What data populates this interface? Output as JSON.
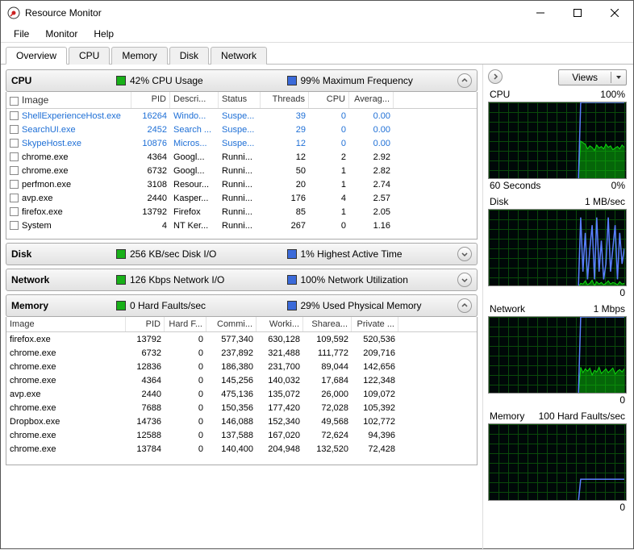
{
  "window": {
    "title": "Resource Monitor"
  },
  "menu": {
    "file": "File",
    "monitor": "Monitor",
    "help": "Help"
  },
  "tabs": {
    "overview": "Overview",
    "cpu": "CPU",
    "memory": "Memory",
    "disk": "Disk",
    "network": "Network"
  },
  "sections": {
    "cpu": {
      "title": "CPU",
      "m1": "42% CPU Usage",
      "m2": "99% Maximum Frequency",
      "cols": {
        "image": "Image",
        "pid": "PID",
        "desc": "Descri...",
        "status": "Status",
        "threads": "Threads",
        "cpu": "CPU",
        "avg": "Averag..."
      }
    },
    "disk": {
      "title": "Disk",
      "m1": "256 KB/sec Disk I/O",
      "m2": "1% Highest Active Time"
    },
    "network": {
      "title": "Network",
      "m1": "126 Kbps Network I/O",
      "m2": "100% Network Utilization"
    },
    "memory": {
      "title": "Memory",
      "m1": "0 Hard Faults/sec",
      "m2": "29% Used Physical Memory",
      "cols": {
        "image": "Image",
        "pid": "PID",
        "hard": "Hard F...",
        "commit": "Commi...",
        "work": "Worki...",
        "share": "Sharea...",
        "priv": "Private ..."
      }
    }
  },
  "cpu_rows": [
    {
      "image": "ShellExperienceHost.exe",
      "pid": "16264",
      "desc": "Windo...",
      "status": "Suspe...",
      "threads": "39",
      "cpu": "0",
      "avg": "0.00",
      "susp": true
    },
    {
      "image": "SearchUI.exe",
      "pid": "2452",
      "desc": "Search ...",
      "status": "Suspe...",
      "threads": "29",
      "cpu": "0",
      "avg": "0.00",
      "susp": true
    },
    {
      "image": "SkypeHost.exe",
      "pid": "10876",
      "desc": "Micros...",
      "status": "Suspe...",
      "threads": "12",
      "cpu": "0",
      "avg": "0.00",
      "susp": true
    },
    {
      "image": "chrome.exe",
      "pid": "4364",
      "desc": "Googl...",
      "status": "Runni...",
      "threads": "12",
      "cpu": "2",
      "avg": "2.92"
    },
    {
      "image": "chrome.exe",
      "pid": "6732",
      "desc": "Googl...",
      "status": "Runni...",
      "threads": "50",
      "cpu": "1",
      "avg": "2.82"
    },
    {
      "image": "perfmon.exe",
      "pid": "3108",
      "desc": "Resour...",
      "status": "Runni...",
      "threads": "20",
      "cpu": "1",
      "avg": "2.74"
    },
    {
      "image": "avp.exe",
      "pid": "2440",
      "desc": "Kasper...",
      "status": "Runni...",
      "threads": "176",
      "cpu": "4",
      "avg": "2.57"
    },
    {
      "image": "firefox.exe",
      "pid": "13792",
      "desc": "Firefox",
      "status": "Runni...",
      "threads": "85",
      "cpu": "1",
      "avg": "2.05"
    },
    {
      "image": "System",
      "pid": "4",
      "desc": "NT Ker...",
      "status": "Runni...",
      "threads": "267",
      "cpu": "0",
      "avg": "1.16"
    }
  ],
  "mem_rows": [
    {
      "image": "firefox.exe",
      "pid": "13792",
      "hard": "0",
      "commit": "577,340",
      "work": "630,128",
      "share": "109,592",
      "priv": "520,536"
    },
    {
      "image": "chrome.exe",
      "pid": "6732",
      "hard": "0",
      "commit": "237,892",
      "work": "321,488",
      "share": "111,772",
      "priv": "209,716"
    },
    {
      "image": "chrome.exe",
      "pid": "12836",
      "hard": "0",
      "commit": "186,380",
      "work": "231,700",
      "share": "89,044",
      "priv": "142,656"
    },
    {
      "image": "chrome.exe",
      "pid": "4364",
      "hard": "0",
      "commit": "145,256",
      "work": "140,032",
      "share": "17,684",
      "priv": "122,348"
    },
    {
      "image": "avp.exe",
      "pid": "2440",
      "hard": "0",
      "commit": "475,136",
      "work": "135,072",
      "share": "26,000",
      "priv": "109,072"
    },
    {
      "image": "chrome.exe",
      "pid": "7688",
      "hard": "0",
      "commit": "150,356",
      "work": "177,420",
      "share": "72,028",
      "priv": "105,392"
    },
    {
      "image": "Dropbox.exe",
      "pid": "14736",
      "hard": "0",
      "commit": "146,088",
      "work": "152,340",
      "share": "49,568",
      "priv": "102,772"
    },
    {
      "image": "chrome.exe",
      "pid": "12588",
      "hard": "0",
      "commit": "137,588",
      "work": "167,020",
      "share": "72,624",
      "priv": "94,396"
    },
    {
      "image": "chrome.exe",
      "pid": "13784",
      "hard": "0",
      "commit": "140,400",
      "work": "204,948",
      "share": "132,520",
      "priv": "72,428"
    }
  ],
  "right": {
    "views": "Views",
    "charts": {
      "cpu": {
        "title": "CPU",
        "rightTop": "100%",
        "leftBot": "60 Seconds",
        "rightBot": "0%"
      },
      "disk": {
        "title": "Disk",
        "rightTop": "1 MB/sec",
        "leftBot": "",
        "rightBot": "0"
      },
      "network": {
        "title": "Network",
        "rightTop": "1 Mbps",
        "leftBot": "",
        "rightBot": "0"
      },
      "memory": {
        "title": "Memory",
        "rightTop": "100 Hard Faults/sec",
        "leftBot": "",
        "rightBot": "0"
      }
    }
  },
  "chart_data": [
    {
      "type": "line",
      "title": "CPU",
      "ylim": [
        0,
        100
      ],
      "xlabel": "60 Seconds",
      "ylabel": "%",
      "series": [
        {
          "name": "Maximum Frequency",
          "values": [
            0,
            0,
            0,
            0,
            0,
            0,
            0,
            0,
            0,
            0,
            0,
            0,
            0,
            0,
            0,
            0,
            0,
            0,
            0,
            0,
            0,
            0,
            0,
            0,
            0,
            0,
            0,
            0,
            0,
            0,
            0,
            0,
            0,
            0,
            0,
            0,
            0,
            0,
            0,
            0,
            100,
            100,
            100,
            100,
            100,
            100,
            100,
            100,
            100,
            100,
            100,
            100,
            100,
            100,
            100,
            100,
            100,
            100,
            100,
            100
          ]
        },
        {
          "name": "CPU Usage",
          "values": [
            0,
            0,
            0,
            0,
            0,
            0,
            0,
            0,
            0,
            0,
            0,
            0,
            0,
            0,
            0,
            0,
            0,
            0,
            0,
            0,
            0,
            0,
            0,
            0,
            0,
            0,
            0,
            0,
            0,
            0,
            0,
            0,
            0,
            0,
            0,
            0,
            0,
            0,
            0,
            0,
            50,
            48,
            46,
            40,
            44,
            42,
            38,
            45,
            41,
            43,
            40,
            46,
            42,
            44,
            39,
            41,
            43,
            40,
            45,
            42
          ]
        }
      ]
    },
    {
      "type": "line",
      "title": "Disk",
      "ylim": [
        0,
        1
      ],
      "ylabel": "MB/sec",
      "series": [
        {
          "name": "Disk I/O",
          "values": [
            0,
            0,
            0,
            0,
            0,
            0,
            0,
            0,
            0,
            0,
            0,
            0,
            0,
            0,
            0,
            0,
            0,
            0,
            0,
            0,
            0,
            0,
            0,
            0,
            0,
            0,
            0,
            0,
            0,
            0,
            0,
            0,
            0,
            0,
            0,
            0,
            0,
            0,
            0,
            0,
            0.9,
            0.2,
            0.7,
            0.1,
            0.5,
            0.8,
            0.1,
            0.9,
            0.2,
            0.6,
            0.1,
            0.3,
            0.9,
            0.2,
            0.5,
            0.8,
            0.1,
            0.7,
            0.3,
            0.5
          ]
        },
        {
          "name": "Highest Active Time",
          "values": [
            0,
            0,
            0,
            0,
            0,
            0,
            0,
            0,
            0,
            0,
            0,
            0,
            0,
            0,
            0,
            0,
            0,
            0,
            0,
            0,
            0,
            0,
            0,
            0,
            0,
            0,
            0,
            0,
            0,
            0,
            0,
            0,
            0,
            0,
            0,
            0,
            0,
            0,
            0,
            0,
            0.05,
            0.04,
            0.08,
            0.03,
            0.05,
            0.09,
            0.02,
            0.07,
            0.04,
            0.06,
            0.03,
            0.05,
            0.08,
            0.04,
            0.06,
            0.05,
            0.03,
            0.07,
            0.04,
            0.05
          ]
        }
      ]
    },
    {
      "type": "line",
      "title": "Network",
      "ylim": [
        0,
        1
      ],
      "ylabel": "Mbps",
      "series": [
        {
          "name": "Network Utilization",
          "values": [
            0,
            0,
            0,
            0,
            0,
            0,
            0,
            0,
            0,
            0,
            0,
            0,
            0,
            0,
            0,
            0,
            0,
            0,
            0,
            0,
            0,
            0,
            0,
            0,
            0,
            0,
            0,
            0,
            0,
            0,
            0,
            0,
            0,
            0,
            0,
            0,
            0,
            0,
            0,
            0,
            1,
            1,
            1,
            1,
            1,
            1,
            1,
            1,
            1,
            1,
            1,
            1,
            1,
            1,
            1,
            1,
            1,
            1,
            1,
            1
          ]
        },
        {
          "name": "Network I/O",
          "values": [
            0,
            0,
            0,
            0,
            0,
            0,
            0,
            0,
            0,
            0,
            0,
            0,
            0,
            0,
            0,
            0,
            0,
            0,
            0,
            0,
            0,
            0,
            0,
            0,
            0,
            0,
            0,
            0,
            0,
            0,
            0,
            0,
            0,
            0,
            0,
            0,
            0,
            0,
            0,
            0,
            0.35,
            0.28,
            0.33,
            0.3,
            0.34,
            0.25,
            0.31,
            0.29,
            0.35,
            0.27,
            0.3,
            0.33,
            0.28,
            0.31,
            0.34,
            0.26,
            0.3,
            0.32,
            0.29,
            0.33
          ]
        }
      ]
    },
    {
      "type": "line",
      "title": "Memory",
      "ylim": [
        0,
        100
      ],
      "ylabel": "Hard Faults/sec",
      "series": [
        {
          "name": "Used Physical Memory",
          "values": [
            0,
            0,
            0,
            0,
            0,
            0,
            0,
            0,
            0,
            0,
            0,
            0,
            0,
            0,
            0,
            0,
            0,
            0,
            0,
            0,
            0,
            0,
            0,
            0,
            0,
            0,
            0,
            0,
            0,
            0,
            0,
            0,
            0,
            0,
            0,
            0,
            0,
            0,
            0,
            0,
            29,
            29,
            29,
            29,
            29,
            29,
            29,
            29,
            29,
            29,
            29,
            29,
            29,
            29,
            29,
            29,
            29,
            29,
            29,
            29
          ]
        },
        {
          "name": "Hard Faults",
          "values": [
            0,
            0,
            0,
            0,
            0,
            0,
            0,
            0,
            0,
            0,
            0,
            0,
            0,
            0,
            0,
            0,
            0,
            0,
            0,
            0,
            0,
            0,
            0,
            0,
            0,
            0,
            0,
            0,
            0,
            0,
            0,
            0,
            0,
            0,
            0,
            0,
            0,
            0,
            0,
            0,
            0,
            0,
            0,
            0,
            0,
            0,
            0,
            0,
            0,
            0,
            0,
            0,
            0,
            0,
            0,
            0,
            0,
            0,
            0,
            0
          ]
        }
      ]
    }
  ]
}
